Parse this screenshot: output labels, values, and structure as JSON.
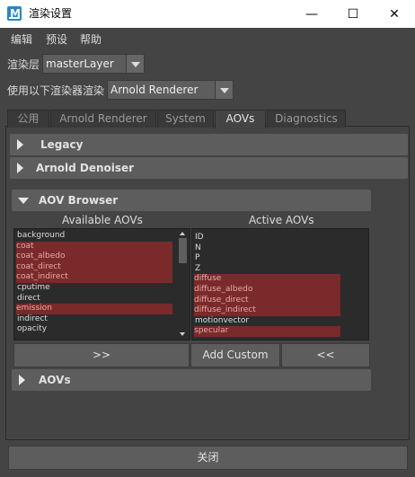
{
  "window": {
    "icon_letter": "M",
    "title": "渲染设置",
    "minimize_glyph": "—",
    "maximize_glyph": "☐",
    "close_glyph": "✕"
  },
  "menu": {
    "items": [
      {
        "label": "编辑"
      },
      {
        "label": "预设"
      },
      {
        "label": "帮助"
      }
    ]
  },
  "render_layer": {
    "label": "渲染层",
    "value": "masterLayer"
  },
  "renderer": {
    "label": "使用以下渲染器渲染",
    "value": "Arnold Renderer"
  },
  "tabs": [
    {
      "label": "公用",
      "active": false
    },
    {
      "label": "Arnold Renderer",
      "active": false
    },
    {
      "label": "System",
      "active": false
    },
    {
      "label": "AOVs",
      "active": true
    },
    {
      "label": "Diagnostics",
      "active": false
    }
  ],
  "sections": {
    "legacy": {
      "title": "Legacy",
      "expanded": false
    },
    "denoiser": {
      "title": "Arnold Denoiser",
      "expanded": false
    },
    "aov_browser": {
      "title": "AOV Browser",
      "expanded": true
    },
    "aovs": {
      "title": "AOVs",
      "expanded": false
    }
  },
  "aov_browser": {
    "available_title": "Available AOVs",
    "active_title": "Active AOVs",
    "available": [
      {
        "name": "background",
        "selected": false
      },
      {
        "name": "coat",
        "selected": true
      },
      {
        "name": "coat_albedo",
        "selected": true
      },
      {
        "name": "coat_direct",
        "selected": true
      },
      {
        "name": "coat_indirect",
        "selected": true
      },
      {
        "name": "cputime",
        "selected": false
      },
      {
        "name": "direct",
        "selected": false
      },
      {
        "name": "emission",
        "selected": true
      },
      {
        "name": "indirect",
        "selected": false
      },
      {
        "name": "opacity",
        "selected": false
      }
    ],
    "active": [
      {
        "name": "ID",
        "selected": false
      },
      {
        "name": "N",
        "selected": false
      },
      {
        "name": "P",
        "selected": false
      },
      {
        "name": "Z",
        "selected": false
      },
      {
        "name": "diffuse",
        "selected": true
      },
      {
        "name": "diffuse_albedo",
        "selected": true
      },
      {
        "name": "diffuse_direct",
        "selected": true
      },
      {
        "name": "diffuse_indirect",
        "selected": true
      },
      {
        "name": "motionvector",
        "selected": false
      },
      {
        "name": "specular",
        "selected": true
      }
    ],
    "add_button": ">>",
    "custom_button": "Add Custom",
    "remove_button": "<<"
  },
  "footer": {
    "close_label": "关闭"
  },
  "colors": {
    "background": "#444444",
    "panel": "#5d5d5d",
    "selection": "#7a2a2a",
    "selection_text": "#e9a9a9",
    "list_bg": "#2b2b2b"
  }
}
